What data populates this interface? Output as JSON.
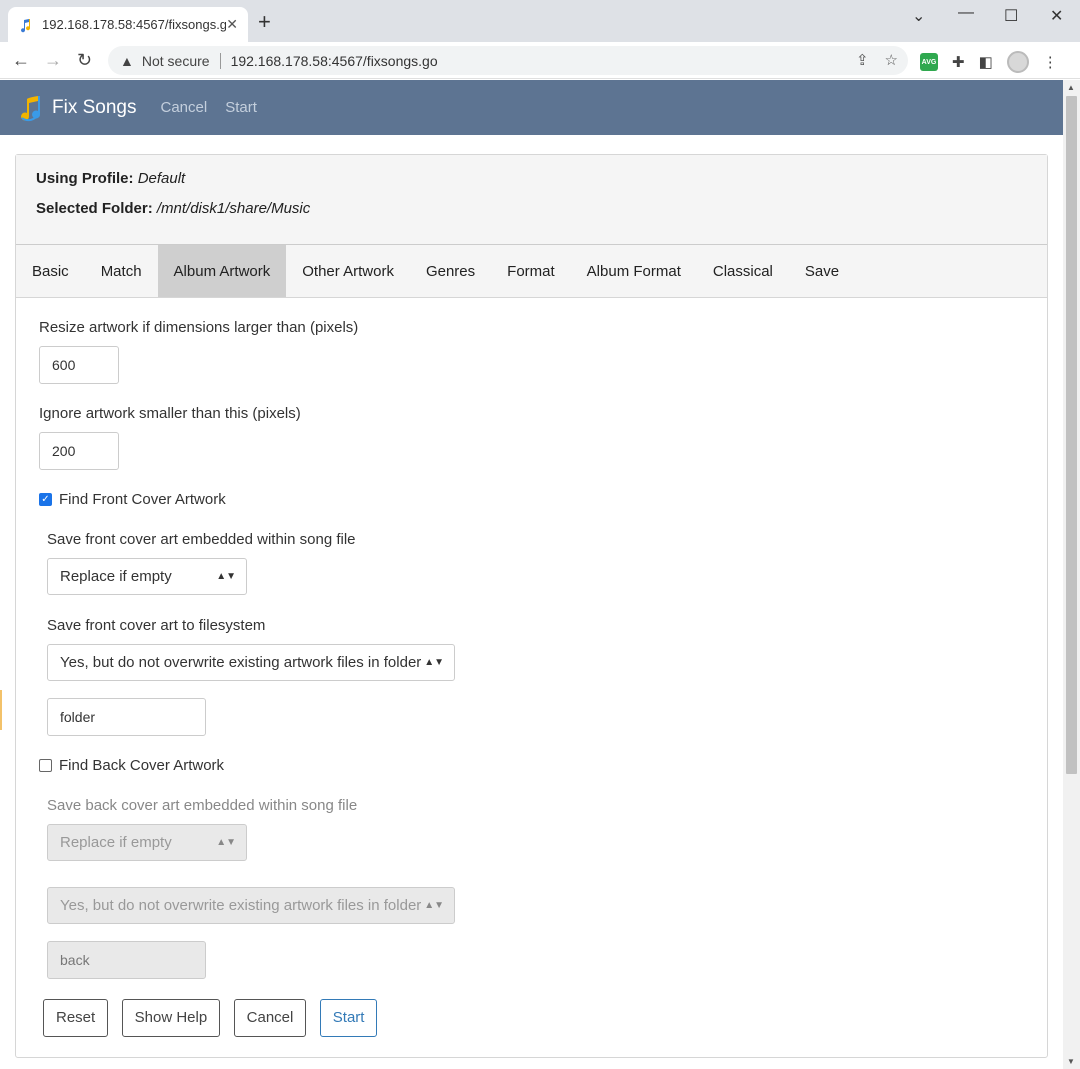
{
  "browser": {
    "tab_title": "192.168.178.58:4567/fixsongs.go",
    "security_label": "Not secure",
    "url": "192.168.178.58:4567/fixsongs.go",
    "extension_badge": "AVG"
  },
  "navbar": {
    "brand": "Fix Songs",
    "links": [
      "Cancel",
      "Start"
    ]
  },
  "header": {
    "profile_label": "Using Profile:",
    "profile_value": "Default",
    "folder_label": "Selected Folder:",
    "folder_value": "/mnt/disk1/share/Music"
  },
  "tabs": [
    "Basic",
    "Match",
    "Album Artwork",
    "Other Artwork",
    "Genres",
    "Format",
    "Album Format",
    "Classical",
    "Save"
  ],
  "active_tab": "Album Artwork",
  "form": {
    "resize_label": "Resize artwork if dimensions larger than (pixels)",
    "resize_value": "600",
    "ignore_label": "Ignore artwork smaller than this (pixels)",
    "ignore_value": "200",
    "front_checkbox_label": "Find Front Cover Artwork",
    "front_checked": true,
    "front_embed_label": "Save front cover art embedded within song file",
    "front_embed_value": "Replace if empty",
    "front_fs_label": "Save front cover art to filesystem",
    "front_fs_value": "Yes, but do not overwrite existing artwork files in folder",
    "front_filename": "folder",
    "back_checkbox_label": "Find Back Cover Artwork",
    "back_checked": false,
    "back_embed_label": "Save back cover art embedded within song file",
    "back_embed_value": "Replace if empty",
    "back_fs_value": "Yes, but do not overwrite existing artwork files in folder",
    "back_filename": "back"
  },
  "buttons": {
    "reset": "Reset",
    "help": "Show Help",
    "cancel": "Cancel",
    "start": "Start"
  },
  "colors": {
    "navbar": "#5d7492",
    "active_tab": "#cfcfcf",
    "primary": "#337ab7"
  }
}
